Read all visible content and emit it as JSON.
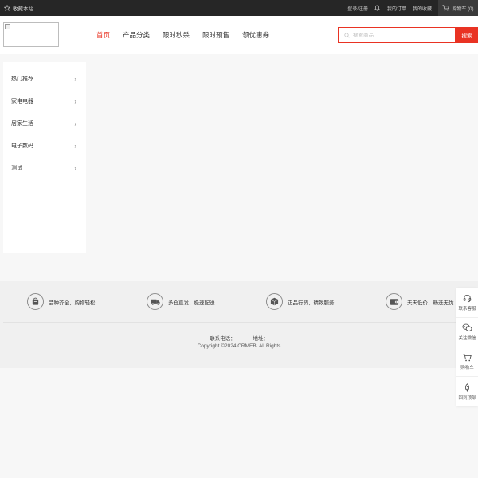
{
  "topbar": {
    "favorite_label": "收藏本站",
    "login_label": "登录/注册",
    "orders_label": "我的订单",
    "collect_label": "我的收藏",
    "cart_label": "购物车 (0)"
  },
  "header": {
    "nav": [
      {
        "label": "首页",
        "active": true
      },
      {
        "label": "产品分类"
      },
      {
        "label": "限时秒杀"
      },
      {
        "label": "限时预售"
      },
      {
        "label": "领优惠券"
      }
    ],
    "search": {
      "placeholder": "搜索商品",
      "button_label": "搜索"
    },
    "accent_color": "#e93323"
  },
  "categories": [
    {
      "label": "热门推荐"
    },
    {
      "label": "家电电器"
    },
    {
      "label": "居家生活"
    },
    {
      "label": "电子数码"
    },
    {
      "label": "测试"
    }
  ],
  "services": [
    {
      "label": "品种齐全，购物轻松",
      "icon": "bag-icon"
    },
    {
      "label": "多仓直发，极速配送",
      "icon": "truck-icon"
    },
    {
      "label": "正品行货，精致服务",
      "icon": "box-icon"
    },
    {
      "label": "天天低价，畅选无忧",
      "icon": "wallet-icon"
    }
  ],
  "footer": {
    "phone_label": "联系电话：",
    "address_label": "地址：",
    "copyright": "Copyright ©2024 CRMEB. All Rights"
  },
  "floatbar": [
    {
      "label": "联系客服",
      "icon": "headset-icon"
    },
    {
      "label": "关注微信",
      "icon": "wechat-icon"
    },
    {
      "label": "购物车",
      "icon": "cart-icon"
    },
    {
      "label": "回到顶部",
      "icon": "rocket-icon"
    }
  ]
}
